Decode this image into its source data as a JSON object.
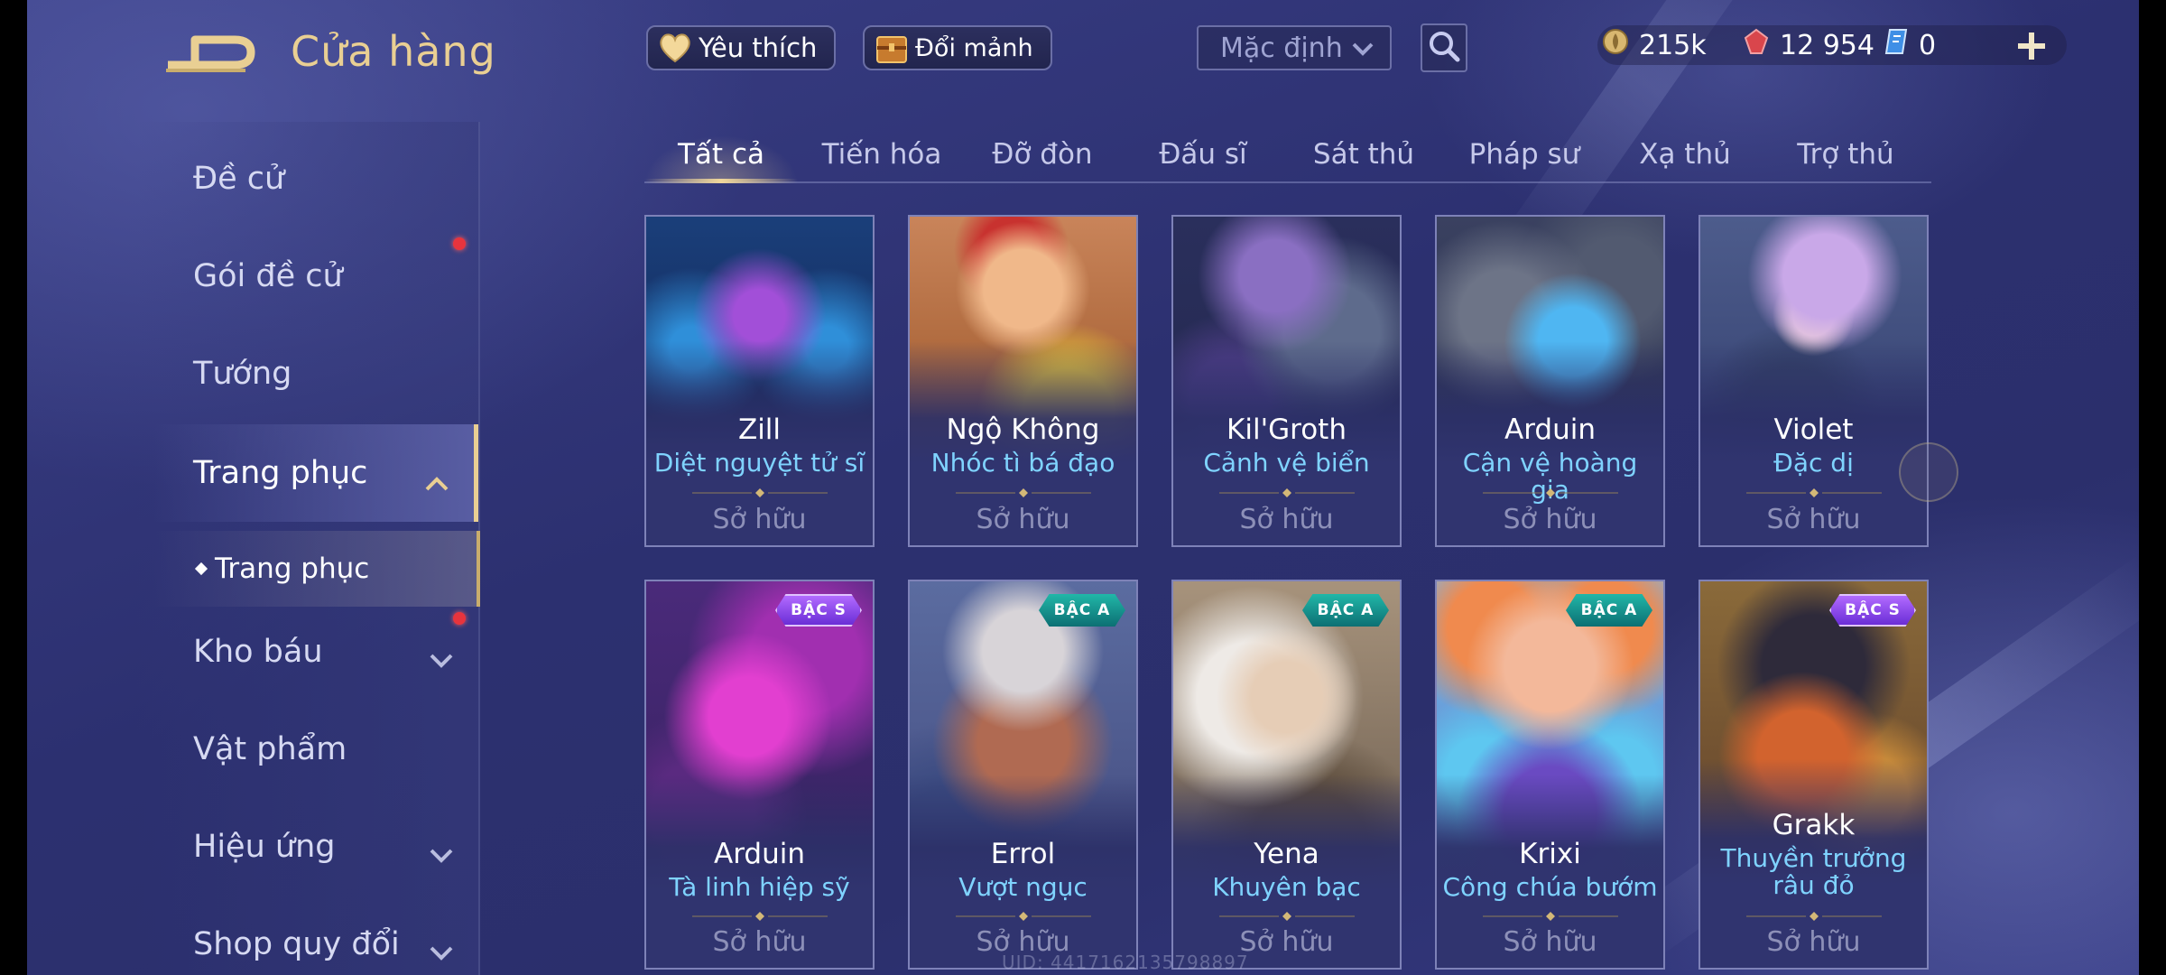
{
  "header": {
    "title": "Cửa hàng",
    "favorites_label": "Yêu thích",
    "fragments_label": "Đổi mảnh",
    "sort_value": "Mặc định"
  },
  "currency": {
    "gold": "215k",
    "gems": "12 954",
    "tickets": "0"
  },
  "sidebar": {
    "items": [
      {
        "label": "Đề cử"
      },
      {
        "label": "Gói đề cử"
      },
      {
        "label": "Tướng"
      },
      {
        "label": "Trang phục"
      },
      {
        "label": "Kho báu"
      },
      {
        "label": "Vật phẩm"
      },
      {
        "label": "Hiệu ứng"
      },
      {
        "label": "Shop quy đổi"
      }
    ],
    "sub_item": "Trang phục"
  },
  "tabs": [
    "Tất cả",
    "Tiến hóa",
    "Đỡ đòn",
    "Đấu sĩ",
    "Sát thủ",
    "Pháp sư",
    "Xạ thủ",
    "Trợ thủ"
  ],
  "cards": [
    {
      "hero": "Zill",
      "skin": "Diệt nguyệt tử sĩ",
      "status": "Sở hữu",
      "tier": ""
    },
    {
      "hero": "Ngộ Không",
      "skin": "Nhóc tì bá đạo",
      "status": "Sở hữu",
      "tier": ""
    },
    {
      "hero": "Kil'Groth",
      "skin": "Cảnh vệ biển",
      "status": "Sở hữu",
      "tier": ""
    },
    {
      "hero": "Arduin",
      "skin": "Cận vệ hoàng gia",
      "status": "Sở hữu",
      "tier": ""
    },
    {
      "hero": "Violet",
      "skin": "Đặc dị",
      "status": "Sở hữu",
      "tier": ""
    },
    {
      "hero": "Arduin",
      "skin": "Tà linh hiệp sỹ",
      "status": "Sở hữu",
      "tier": "BẬC S"
    },
    {
      "hero": "Errol",
      "skin": "Vượt ngục",
      "status": "Sở hữu",
      "tier": "BẬC A"
    },
    {
      "hero": "Yena",
      "skin": "Khuyên bạc",
      "status": "Sở hữu",
      "tier": "BẬC A"
    },
    {
      "hero": "Krixi",
      "skin": "Công chúa bướm",
      "status": "Sở hữu",
      "tier": "BẬC A"
    },
    {
      "hero": "Grakk",
      "skin": "Thuyền trưởng râu đỏ",
      "status": "Sở hữu",
      "tier": "BẬC S"
    }
  ],
  "uid": "UID: 4417162135798897",
  "colors": {
    "accent_gold": "#e9cf93",
    "skin_name": "#7fd3ff",
    "notification": "#e8343d"
  }
}
